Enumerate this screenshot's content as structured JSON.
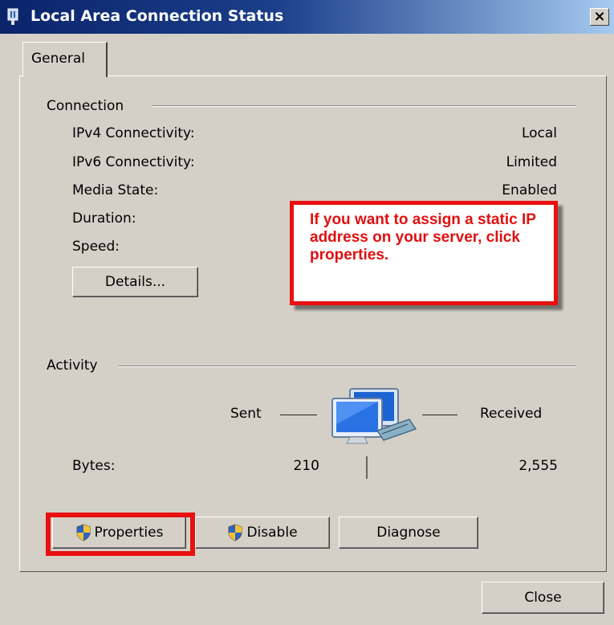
{
  "window": {
    "title": "Local Area Connection Status",
    "close_glyph": "×"
  },
  "tabs": [
    {
      "label": "General"
    }
  ],
  "connection": {
    "group_label": "Connection",
    "rows": [
      {
        "label": "IPv4 Connectivity:",
        "value": "Local"
      },
      {
        "label": "IPv6 Connectivity:",
        "value": "Limited"
      },
      {
        "label": "Media State:",
        "value": "Enabled"
      },
      {
        "label": "Duration:",
        "value": ""
      },
      {
        "label": "Speed:",
        "value": ""
      }
    ],
    "details_button": "Details..."
  },
  "callout": {
    "text": "If you want to assign a static IP address on your server, click properties."
  },
  "activity": {
    "group_label": "Activity",
    "sent_label": "Sent",
    "received_label": "Received",
    "bytes_label": "Bytes:",
    "bytes_sent": "210",
    "bytes_received": "2,555",
    "icon": "network-computers-icon"
  },
  "buttons": {
    "properties": "Properties",
    "disable": "Disable",
    "diagnose": "Diagnose",
    "close": "Close"
  },
  "colors": {
    "dialog_bg": "#d4d0c8",
    "title_bar": "#0a246a",
    "highlight_red": "#e81010"
  }
}
